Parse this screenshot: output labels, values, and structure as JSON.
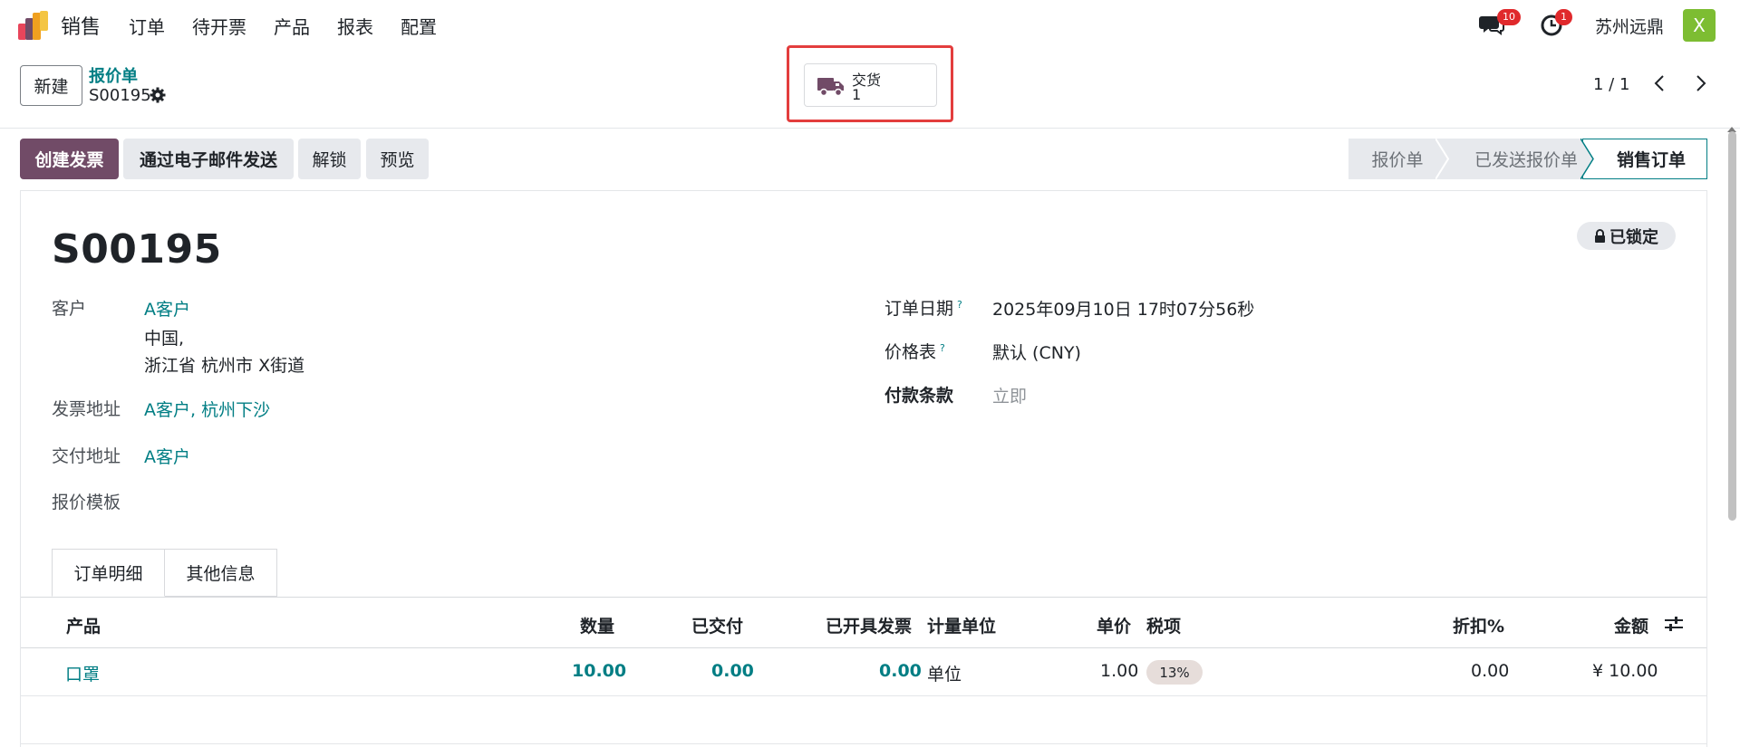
{
  "nav": {
    "app_name": "销售",
    "menu": [
      "订单",
      "待开票",
      "产品",
      "报表",
      "配置"
    ],
    "chat_badge": "10",
    "activity_badge": "1",
    "company": "苏州远鼎",
    "avatar_initial": "X"
  },
  "control": {
    "new_label": "新建",
    "breadcrumb_parent": "报价单",
    "breadcrumb_current": "S00195",
    "delivery_label": "交货",
    "delivery_count": "1",
    "pager": "1 / 1"
  },
  "actions": {
    "create_invoice": "创建发票",
    "send_email": "通过电子邮件发送",
    "unlock": "解锁",
    "preview": "预览"
  },
  "status": {
    "stages": [
      "报价单",
      "已发送报价单",
      "销售订单"
    ],
    "current": "销售订单"
  },
  "form": {
    "locked": "已锁定",
    "title": "S00195",
    "customer_label": "客户",
    "customer_name": "A客户",
    "customer_addr1": "中国,",
    "customer_addr2": "浙江省 杭州市 X街道",
    "invoice_addr_label": "发票地址",
    "invoice_addr": "A客户, 杭州下沙",
    "delivery_addr_label": "交付地址",
    "delivery_addr": "A客户",
    "template_label": "报价模板",
    "order_date_label": "订单日期",
    "order_date": "2025年09月10日 17时07分56秒",
    "pricelist_label": "价格表",
    "pricelist": "默认 (CNY)",
    "payment_terms_label": "付款条款",
    "payment_terms_placeholder": "立即",
    "help_mark": "?"
  },
  "tabs": [
    "订单明细",
    "其他信息"
  ],
  "table": {
    "headers": {
      "product": "产品",
      "qty": "数量",
      "delivered": "已交付",
      "invoiced": "已开具发票",
      "uom": "计量单位",
      "price": "单价",
      "tax": "税项",
      "discount": "折扣%",
      "amount": "金额"
    },
    "rows": [
      {
        "product": "口罩",
        "qty": "10.00",
        "delivered": "0.00",
        "invoiced": "0.00",
        "uom": "单位",
        "price": "1.00",
        "tax": "13%",
        "discount": "0.00",
        "amount": "¥ 10.00"
      }
    ]
  },
  "colors": {
    "brand": "#714b67",
    "link": "#017e84",
    "highlight": "#e33d3d",
    "badge": "#e0292c"
  }
}
